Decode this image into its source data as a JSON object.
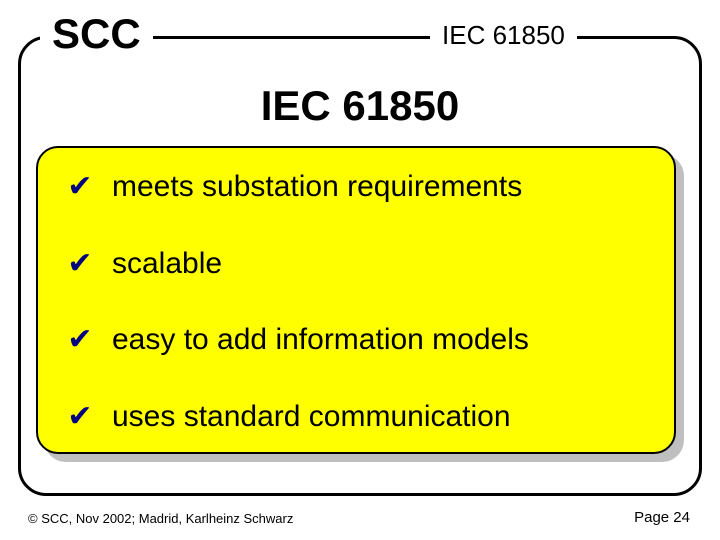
{
  "logo": "SCC",
  "header_right": "IEC 61850",
  "title": "IEC 61850",
  "items": [
    "meets substation requirements",
    "scalable",
    "easy to add information models",
    "uses standard communication"
  ],
  "footer_left": "© SCC, Nov 2002; Madrid, Karlheinz Schwarz",
  "footer_right": "Page 24"
}
